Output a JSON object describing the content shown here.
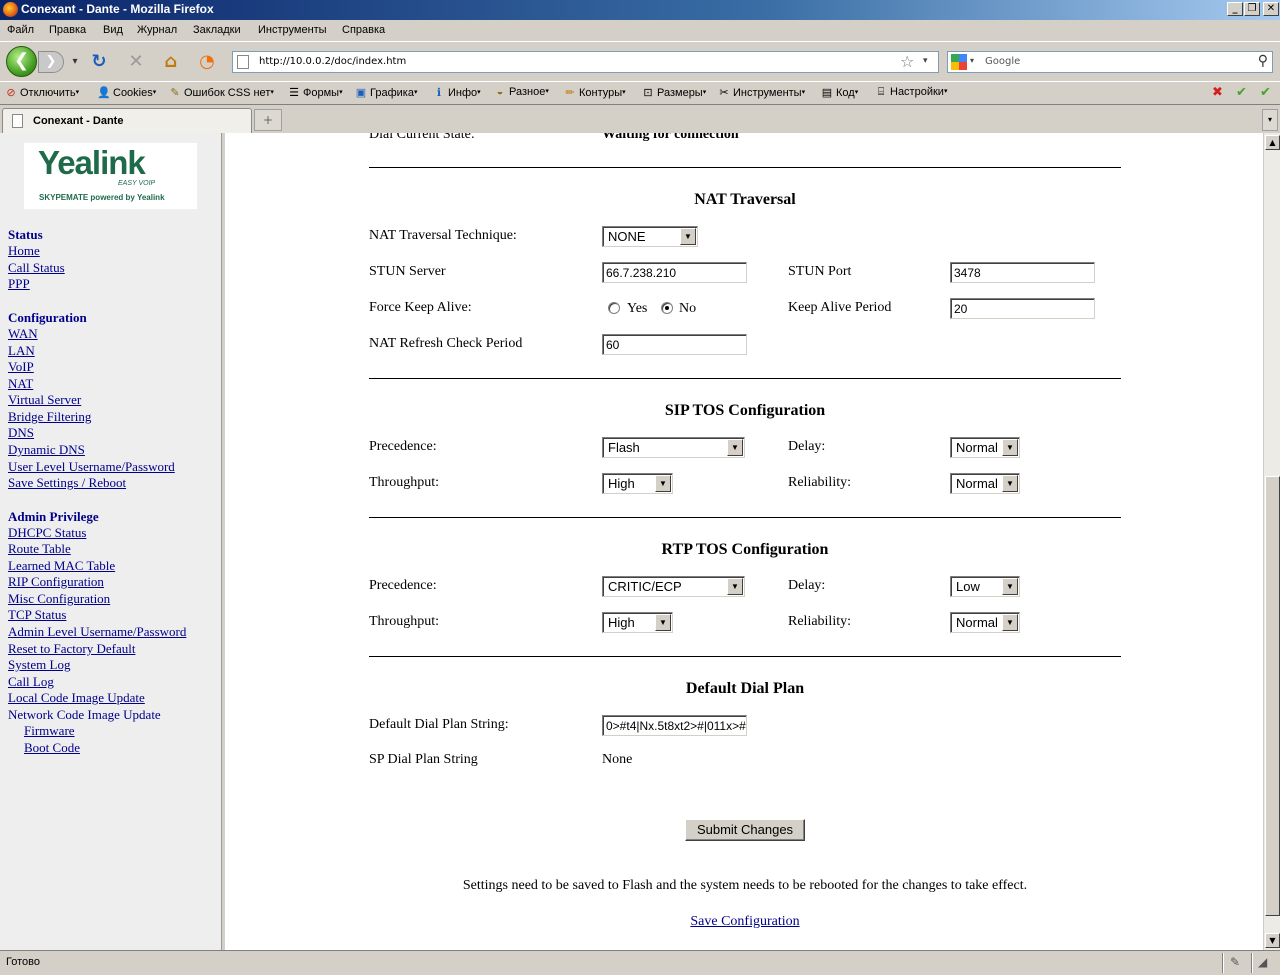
{
  "window": {
    "title": "Conexant - Dante - Mozilla Firefox",
    "min": "_",
    "max": "❐",
    "close": "✕"
  },
  "menu": [
    "Файл",
    "Правка",
    "Вид",
    "Журнал",
    "Закладки",
    "Инструменты",
    "Справка"
  ],
  "nav": {
    "back_glyph": "❮",
    "forward_glyph": "❯",
    "history_dd": "▾",
    "reload_glyph": "↻",
    "stop_glyph": "✕",
    "home_glyph": "⌂",
    "rss_glyph": "◔",
    "url": "http://10.0.0.2/doc/index.htm",
    "bookmark_glyph": "☆",
    "url_dd": "▾",
    "search_placeholder": "Google",
    "search_engine_dd": "▾",
    "search_glyph": "⚲"
  },
  "devbar": [
    {
      "icon": "⊘",
      "label": "Отключить"
    },
    {
      "icon": "👤",
      "label": "Cookies"
    },
    {
      "icon": "✎",
      "label": "Ошибок CSS нет"
    },
    {
      "icon": "☰",
      "label": "Формы"
    },
    {
      "icon": "▣",
      "label": "Графика"
    },
    {
      "icon": "ℹ",
      "label": "Инфо"
    },
    {
      "icon": "◒",
      "label": "Разное"
    },
    {
      "icon": "✏",
      "label": "Контуры"
    },
    {
      "icon": "⊡",
      "label": "Размеры"
    },
    {
      "icon": "✂",
      "label": "Инструменты"
    },
    {
      "icon": "▤",
      "label": "Код"
    },
    {
      "icon": "⌸",
      "label": "Настройки"
    }
  ],
  "devbar_right": {
    "error": "✖",
    "ok1": "✔",
    "ok2": "✔"
  },
  "tab": {
    "label": "Conexant - Dante",
    "new_tab": "+",
    "list": "▾"
  },
  "logo": {
    "brand": "Yealink",
    "subtitle": "EASY VOIP",
    "tagline": "SKYPEMATE powered by Yealink"
  },
  "sidebar": {
    "status_title": "Status",
    "status_links": [
      "Home",
      "Call Status",
      "PPP"
    ],
    "config_title": "Configuration",
    "config_links": [
      "WAN",
      "LAN",
      "VoIP",
      "NAT",
      "Virtual Server",
      "Bridge Filtering",
      "DNS",
      "Dynamic DNS",
      "User Level Username/Password",
      "Save Settings / Reboot"
    ],
    "admin_title": "Admin Privilege",
    "admin_links": [
      "DHCPC Status",
      "Route Table",
      "Learned MAC Table",
      "RIP Configuration",
      "Misc Configuration",
      "TCP Status",
      "Admin Level Username/Password",
      "Reset to Factory Default",
      "System Log",
      "Call Log",
      "Local Code Image Update",
      "Network Code Image Update"
    ],
    "sub_links": [
      "Firmware",
      "Boot Code"
    ]
  },
  "content": {
    "top_cut_label": "Dial Current State:",
    "top_cut_value": "Waiting for connection",
    "nat": {
      "title": "NAT Traversal",
      "technique_label": "NAT Traversal Technique:",
      "technique_value": "NONE",
      "stun_server_label": "STUN Server",
      "stun_server_value": "66.7.238.210",
      "stun_port_label": "STUN Port",
      "stun_port_value": "3478",
      "force_keepalive_label": "Force Keep Alive:",
      "yes_label": "Yes",
      "no_label": "No",
      "force_keepalive_selected": "No",
      "keepalive_period_label": "Keep Alive Period",
      "keepalive_period_value": "20",
      "refresh_label": "NAT Refresh Check Period",
      "refresh_value": "60"
    },
    "sip_tos": {
      "title": "SIP TOS Configuration",
      "precedence_label": "Precedence:",
      "precedence_value": "Flash",
      "delay_label": "Delay:",
      "delay_value": "Normal",
      "throughput_label": "Throughput:",
      "throughput_value": "High",
      "reliability_label": "Reliability:",
      "reliability_value": "Normal"
    },
    "rtp_tos": {
      "title": "RTP TOS Configuration",
      "precedence_label": "Precedence:",
      "precedence_value": "CRITIC/ECP",
      "delay_label": "Delay:",
      "delay_value": "Low",
      "throughput_label": "Throughput:",
      "throughput_value": "High",
      "reliability_label": "Reliability:",
      "reliability_value": "Normal"
    },
    "dial_plan": {
      "title": "Default Dial Plan",
      "string_label": "Default Dial Plan String:",
      "string_value": "0>#t4|Nx.5t8xt2>#|011x>#",
      "sp_label": "SP Dial Plan String",
      "sp_value": "None"
    },
    "submit_label": "Submit Changes",
    "note": "Settings need to be saved to Flash and the system needs to be rebooted for the changes to take effect.",
    "save_link": "Save Configuration"
  },
  "status": {
    "text": "Готово"
  },
  "select_arrow": "▼",
  "scroll": {
    "up": "▲",
    "down": "▼"
  }
}
